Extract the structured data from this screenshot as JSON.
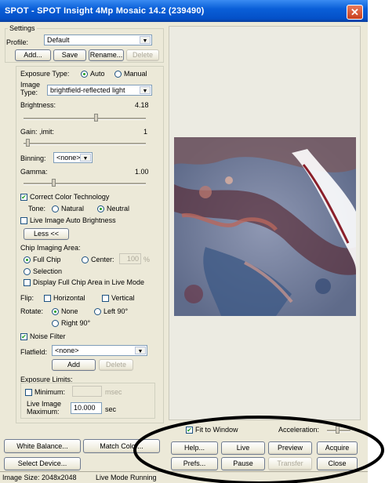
{
  "window": {
    "title": "SPOT - SPOT Insight 4Mp Mosaic 14.2 (239490)",
    "close_glyph": "✕"
  },
  "settings": {
    "group_label": "Settings",
    "profile_label": "Profile:",
    "profile_value": "Default",
    "add_label": "Add...",
    "save_label": "Save",
    "rename_label": "Rename...",
    "delete_label": "Delete"
  },
  "exposure": {
    "type_label": "Exposure Type:",
    "auto_label": "Auto",
    "manual_label": "Manual",
    "selected": "Auto",
    "image_type_label_1": "Image",
    "image_type_label_2": "Type:",
    "image_type_value": "brightfield-reflected light",
    "brightness_label": "Brightness:",
    "brightness_value": "4.18",
    "gain_label": "Gain: ,imit:",
    "gain_value": "1",
    "binning_label": "Binning:",
    "binning_value": "<none>",
    "gamma_label": "Gamma:",
    "gamma_value": "1.00"
  },
  "color": {
    "correct_color_label": "Correct Color Technology",
    "correct_color_checked": true,
    "tone_label": "Tone:",
    "natural_label": "Natural",
    "neutral_label": "Neutral",
    "tone_selected": "Neutral",
    "auto_brightness_label": "Live Image Auto Brightness",
    "auto_brightness_checked": false,
    "less_label": "Less <<"
  },
  "chip": {
    "area_label": "Chip Imaging Area:",
    "full_chip_label": "Full Chip",
    "center_label": "Center:",
    "center_value": "100",
    "center_unit": "%",
    "selection_label": "Selection",
    "selected": "Full Chip",
    "display_full_label": "Display Full Chip Area in Live Mode",
    "display_full_checked": false
  },
  "orientation": {
    "flip_label": "Flip:",
    "horizontal_label": "Horizontal",
    "vertical_label": "Vertical",
    "rotate_label": "Rotate:",
    "none_label": "None",
    "left90_label": "Left 90°",
    "right90_label": "Right 90°",
    "rotate_selected": "None"
  },
  "noise": {
    "noise_filter_label": "Noise Filter",
    "noise_filter_checked": true,
    "flatfield_label": "Flatfield:",
    "flatfield_value": "<none>",
    "add_label": "Add",
    "delete_label": "Delete"
  },
  "limits": {
    "group_label": "Exposure Limits:",
    "minimum_label": "Minimum:",
    "minimum_unit": "msec",
    "live_max_label_1": "Live Image",
    "live_max_label_2": "Maximum:",
    "live_max_value": "10.000",
    "live_max_unit": "sec"
  },
  "bottom_left": {
    "white_balance_label": "White Balance...",
    "match_color_label": "Match Color...",
    "select_device_label": "Select Device..."
  },
  "preview": {
    "fit_label": "Fit to Window",
    "fit_checked": true,
    "acceleration_label": "Acceleration:"
  },
  "actions": {
    "help_label": "Help...",
    "live_label": "Live",
    "preview_label": "Preview",
    "acquire_label": "Acquire",
    "prefs_label": "Prefs...",
    "pause_label": "Pause",
    "transfer_label": "Transfer",
    "close_label": "Close"
  },
  "status": {
    "image_size": "Image Size: 2048x2048",
    "mode": "Live Mode Running"
  },
  "check_glyph": "✔",
  "arrow_glyph": "▼",
  "colors": {
    "titlebar": "#0450c8",
    "panel": "#ece9d8",
    "annotation": "#000000"
  }
}
